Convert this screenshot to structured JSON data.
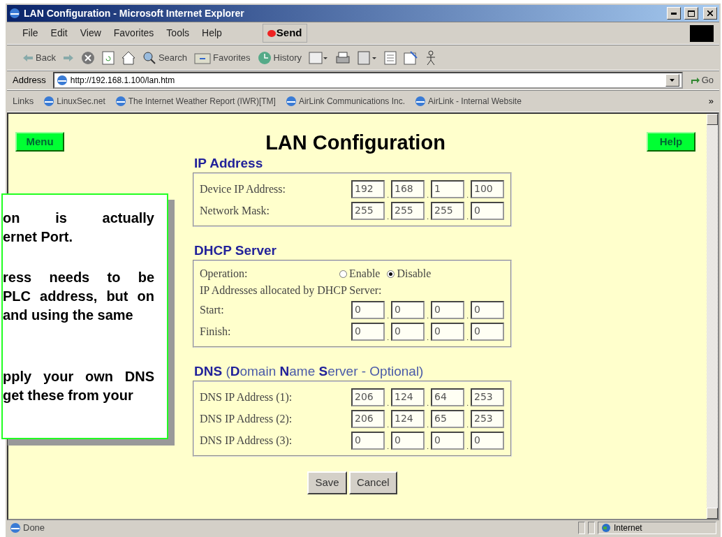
{
  "window": {
    "title": "LAN Configuration - Microsoft Internet Explorer"
  },
  "menu_bar": {
    "items": [
      "File",
      "Edit",
      "View",
      "Favorites",
      "Tools",
      "Help"
    ],
    "send": "Send"
  },
  "toolbar": {
    "back": "Back",
    "search": "Search",
    "favorites": "Favorites",
    "history": "History"
  },
  "address_bar": {
    "label": "Address",
    "url": "http://192.168.1.100/lan.htm",
    "go": "Go"
  },
  "links_bar": {
    "label": "Links",
    "links": [
      "LinuxSec.net",
      "The Internet Weather Report (IWR)[TM]",
      "AirLink Communications Inc.",
      "AirLink - Internal Website"
    ],
    "more": "»"
  },
  "page": {
    "menu_button": "Menu",
    "help_button": "Help",
    "title": "LAN Configuration",
    "octet_separator": ".",
    "sections": [
      {
        "heading": "IP Address",
        "rows": [
          {
            "kind": "ip",
            "label": "Device IP Address:",
            "octets": [
              "192",
              "168",
              "1",
              "100"
            ]
          },
          {
            "kind": "ip",
            "label": "Network Mask:",
            "octets": [
              "255",
              "255",
              "255",
              "0"
            ]
          }
        ]
      },
      {
        "heading": "DHCP Server",
        "rows": [
          {
            "kind": "radio",
            "label": "Operation:",
            "options": [
              {
                "label": "Enable",
                "selected": false
              },
              {
                "label": "Disable",
                "selected": true
              }
            ]
          },
          {
            "kind": "note",
            "label": "IP Addresses allocated by DHCP Server:"
          },
          {
            "kind": "ip",
            "label": "Start:",
            "octets": [
              "0",
              "0",
              "0",
              "0"
            ]
          },
          {
            "kind": "ip",
            "label": "Finish:",
            "octets": [
              "0",
              "0",
              "0",
              "0"
            ]
          }
        ]
      },
      {
        "heading": "**DNS** (**D**omain **N**ame **S**erver - Optional)",
        "rows": [
          {
            "kind": "ip",
            "label": "DNS IP Address (1):",
            "octets": [
              "206",
              "124",
              "64",
              "253"
            ]
          },
          {
            "kind": "ip",
            "label": "DNS IP Address (2):",
            "octets": [
              "206",
              "124",
              "65",
              "253"
            ]
          },
          {
            "kind": "ip",
            "label": "DNS IP Address (3):",
            "octets": [
              "0",
              "0",
              "0",
              "0"
            ]
          }
        ]
      }
    ],
    "buttons": [
      "Save",
      "Cancel"
    ]
  },
  "callout": {
    "paragraphs": [
      [
        "on is actually",
        "ernet Port."
      ],
      [
        "ress needs to be",
        "PLC address, but on",
        "and using the same"
      ],
      [
        "pply your own DNS",
        "get these from your"
      ]
    ]
  },
  "status_bar": {
    "text": "Done",
    "zone": "Internet"
  }
}
